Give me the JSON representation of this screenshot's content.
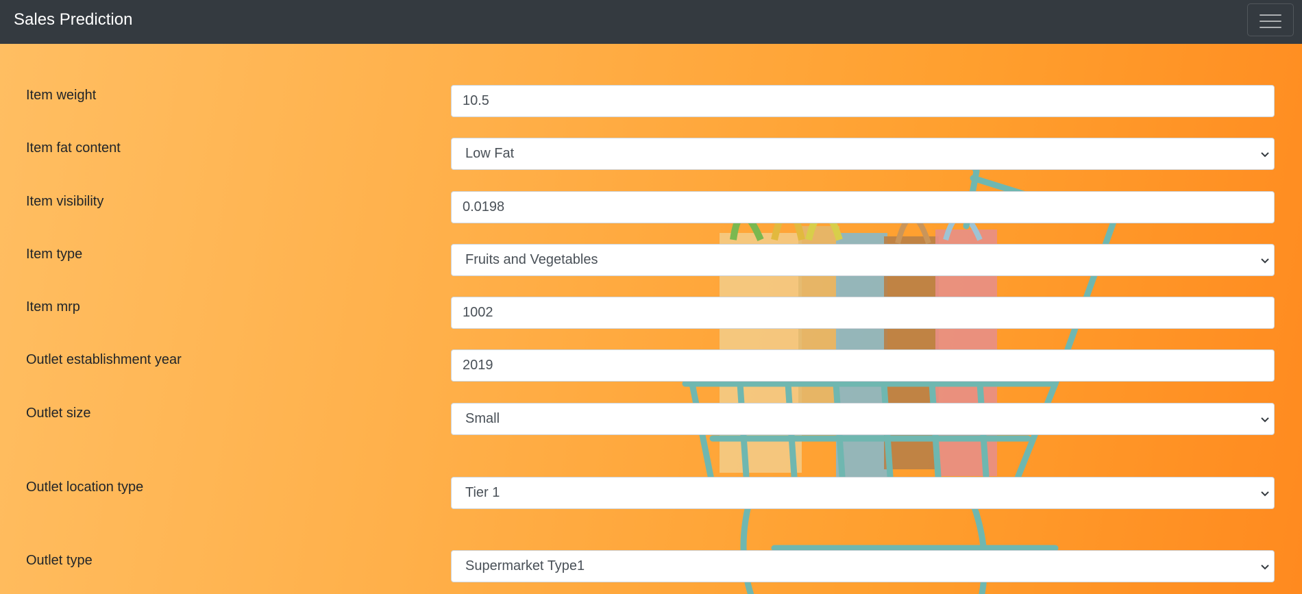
{
  "navbar": {
    "brand": "Sales Prediction",
    "menu_icon": "hamburger-menu-icon"
  },
  "form": {
    "item_weight": {
      "label": "Item weight",
      "value": "10.5"
    },
    "item_fat_content": {
      "label": "Item fat content",
      "value": "Low Fat"
    },
    "item_visibility": {
      "label": "Item visibility",
      "value": "0.0198"
    },
    "item_type": {
      "label": "Item type",
      "value": "Fruits and Vegetables"
    },
    "item_mrp": {
      "label": "Item mrp",
      "value": "1002"
    },
    "outlet_establishment_year": {
      "label": "Outlet establishment year",
      "value": "2019"
    },
    "outlet_size": {
      "label": "Outlet size",
      "value": "Small"
    },
    "outlet_location_type": {
      "label": "Outlet location type",
      "value": "Tier 1"
    },
    "outlet_type": {
      "label": "Outlet type",
      "value": "Supermarket Type1"
    }
  },
  "background": {
    "image": "shopping-cart-with-bags",
    "colors": [
      "#ffbe62",
      "#ff8a1f"
    ]
  }
}
